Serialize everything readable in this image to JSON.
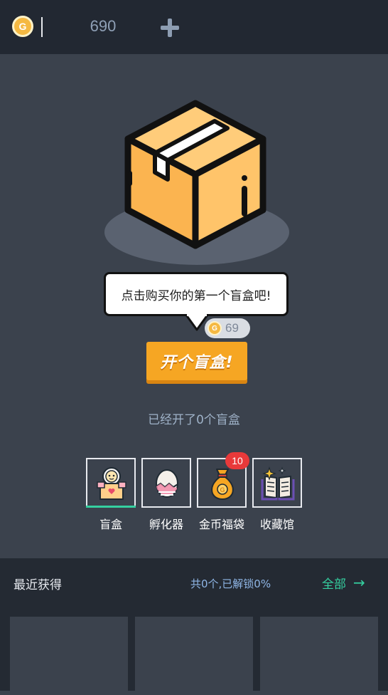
{
  "topbar": {
    "coin_symbol": "G",
    "balance": "690",
    "add_icon": "plus-icon"
  },
  "hero": {
    "box_icon": "cardboard-box-icon",
    "bubble_text": "点击购买你的第一个盲盒吧!",
    "price": {
      "coin_symbol": "G",
      "value": "69"
    },
    "open_button_label": "开个盲盒!",
    "opened_count_text": "已经开了0个盲盒"
  },
  "nav": {
    "items": [
      {
        "label": "盲盒",
        "icon": "blind-box-icon",
        "active": true
      },
      {
        "label": "孵化器",
        "icon": "egg-incubator-icon",
        "active": false
      },
      {
        "label": "金币福袋",
        "icon": "coin-bag-icon",
        "active": false,
        "badge": "10"
      },
      {
        "label": "收藏馆",
        "icon": "collection-book-icon",
        "active": false
      }
    ]
  },
  "recent": {
    "title": "最近获得",
    "stats": "共0个,已解锁0%",
    "view_all_label": "全部",
    "arrow": "→"
  },
  "colors": {
    "accent_green": "#35d0a0",
    "button_orange": "#f6a623",
    "badge_red": "#e8393a",
    "background": "#3b424d",
    "bar": "#222832"
  }
}
